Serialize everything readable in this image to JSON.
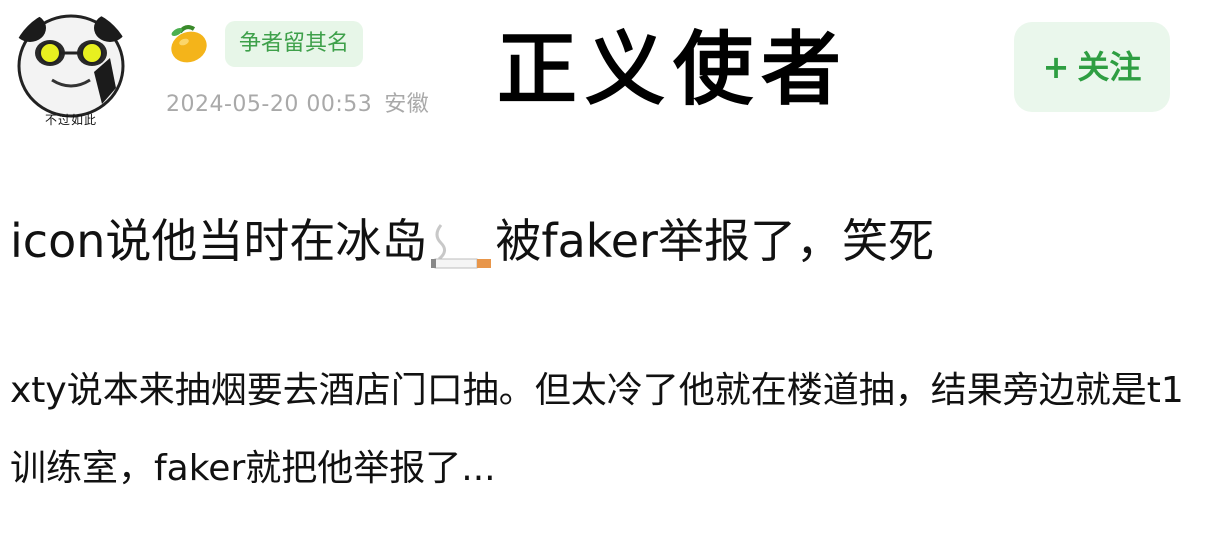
{
  "user": {
    "avatar_caption": "不过如此",
    "badge": "争者留其名",
    "date": "2024-05-20 00:53",
    "location": "安徽"
  },
  "overlay_title": "正义使者",
  "follow_button": {
    "icon": "plus-icon",
    "label": "关注"
  },
  "post": {
    "title_before": "icon说他当时在冰岛",
    "title_emoji": "cigarette-icon",
    "title_after": "被faker举报了，笑死",
    "body": "xty说本来抽烟要去酒店门口抽。但太冷了他就在楼道抽，结果旁边就是t1训练室，faker就把他举报了..."
  },
  "colors": {
    "badge_bg": "#e7f6e8",
    "badge_text": "#3ea04a",
    "follow_bg": "#eaf7ec",
    "follow_text": "#2e9e42",
    "meta_text": "#a9a9a9"
  }
}
